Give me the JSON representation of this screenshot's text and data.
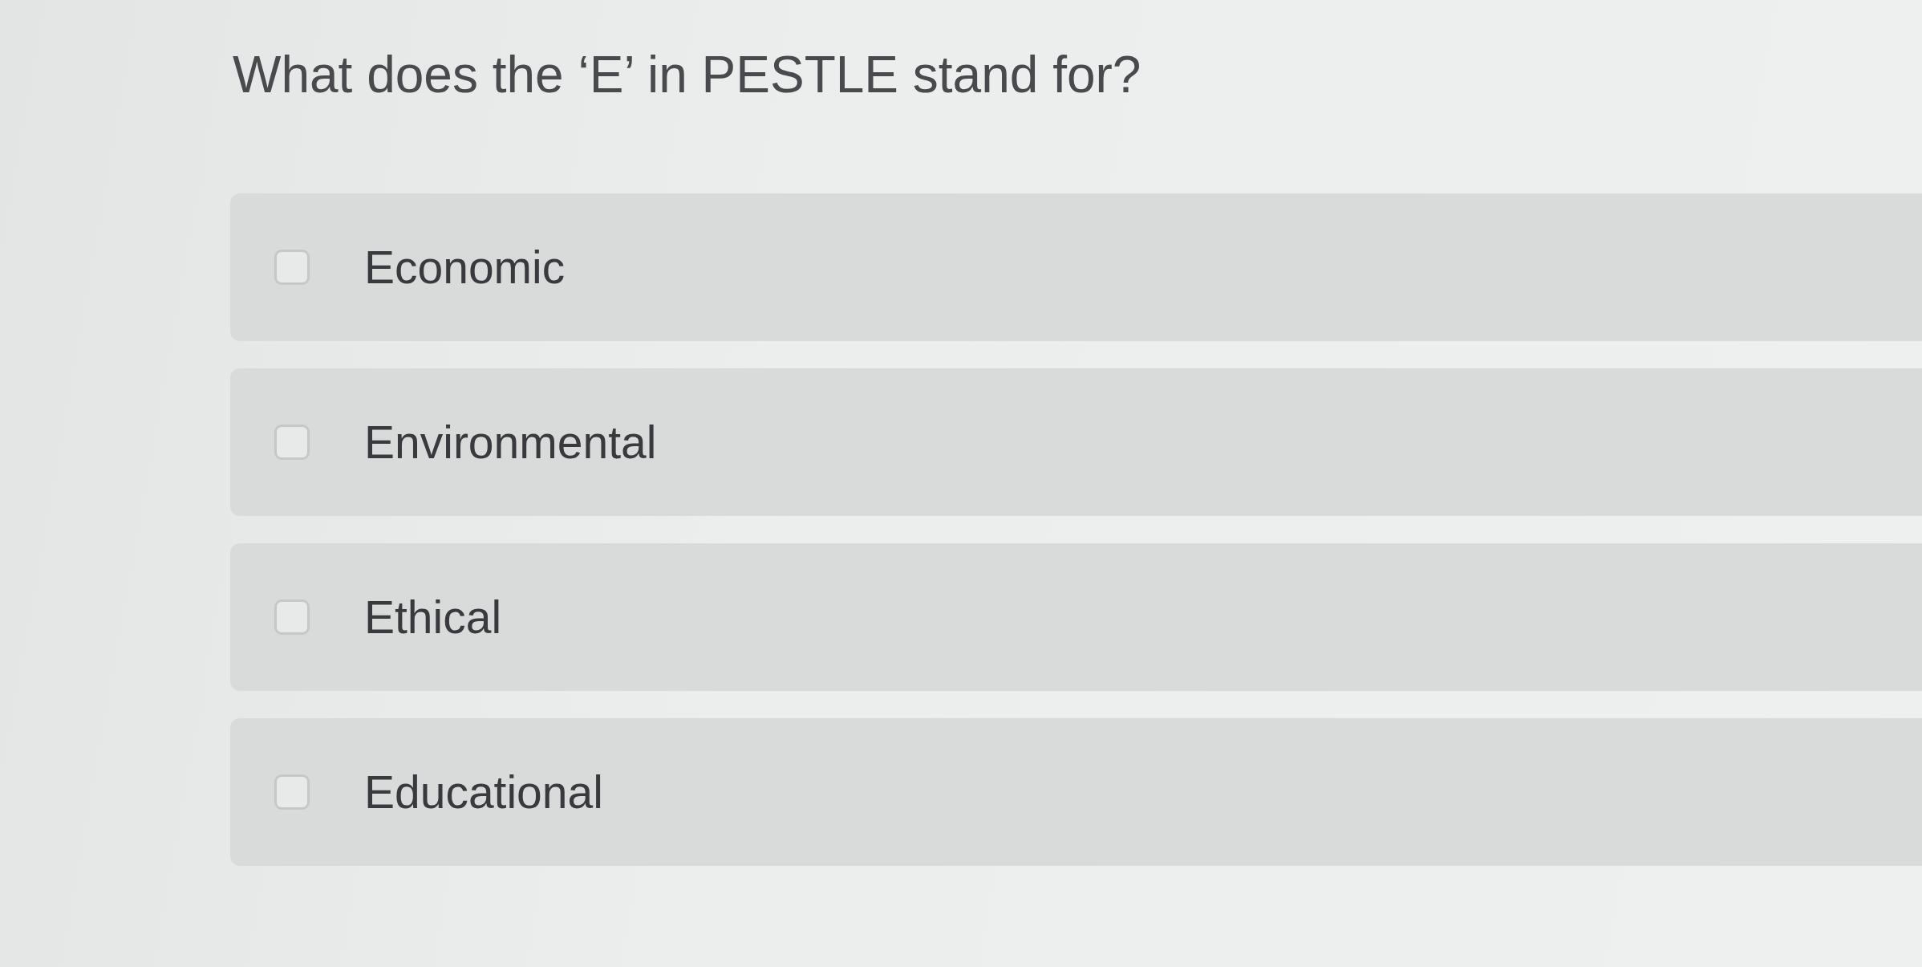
{
  "question": "What does the ‘E’ in PESTLE stand for?",
  "options": [
    {
      "label": "Economic",
      "checked": false
    },
    {
      "label": "Environmental",
      "checked": false
    },
    {
      "label": "Ethical",
      "checked": false
    },
    {
      "label": "Educational",
      "checked": false
    }
  ]
}
